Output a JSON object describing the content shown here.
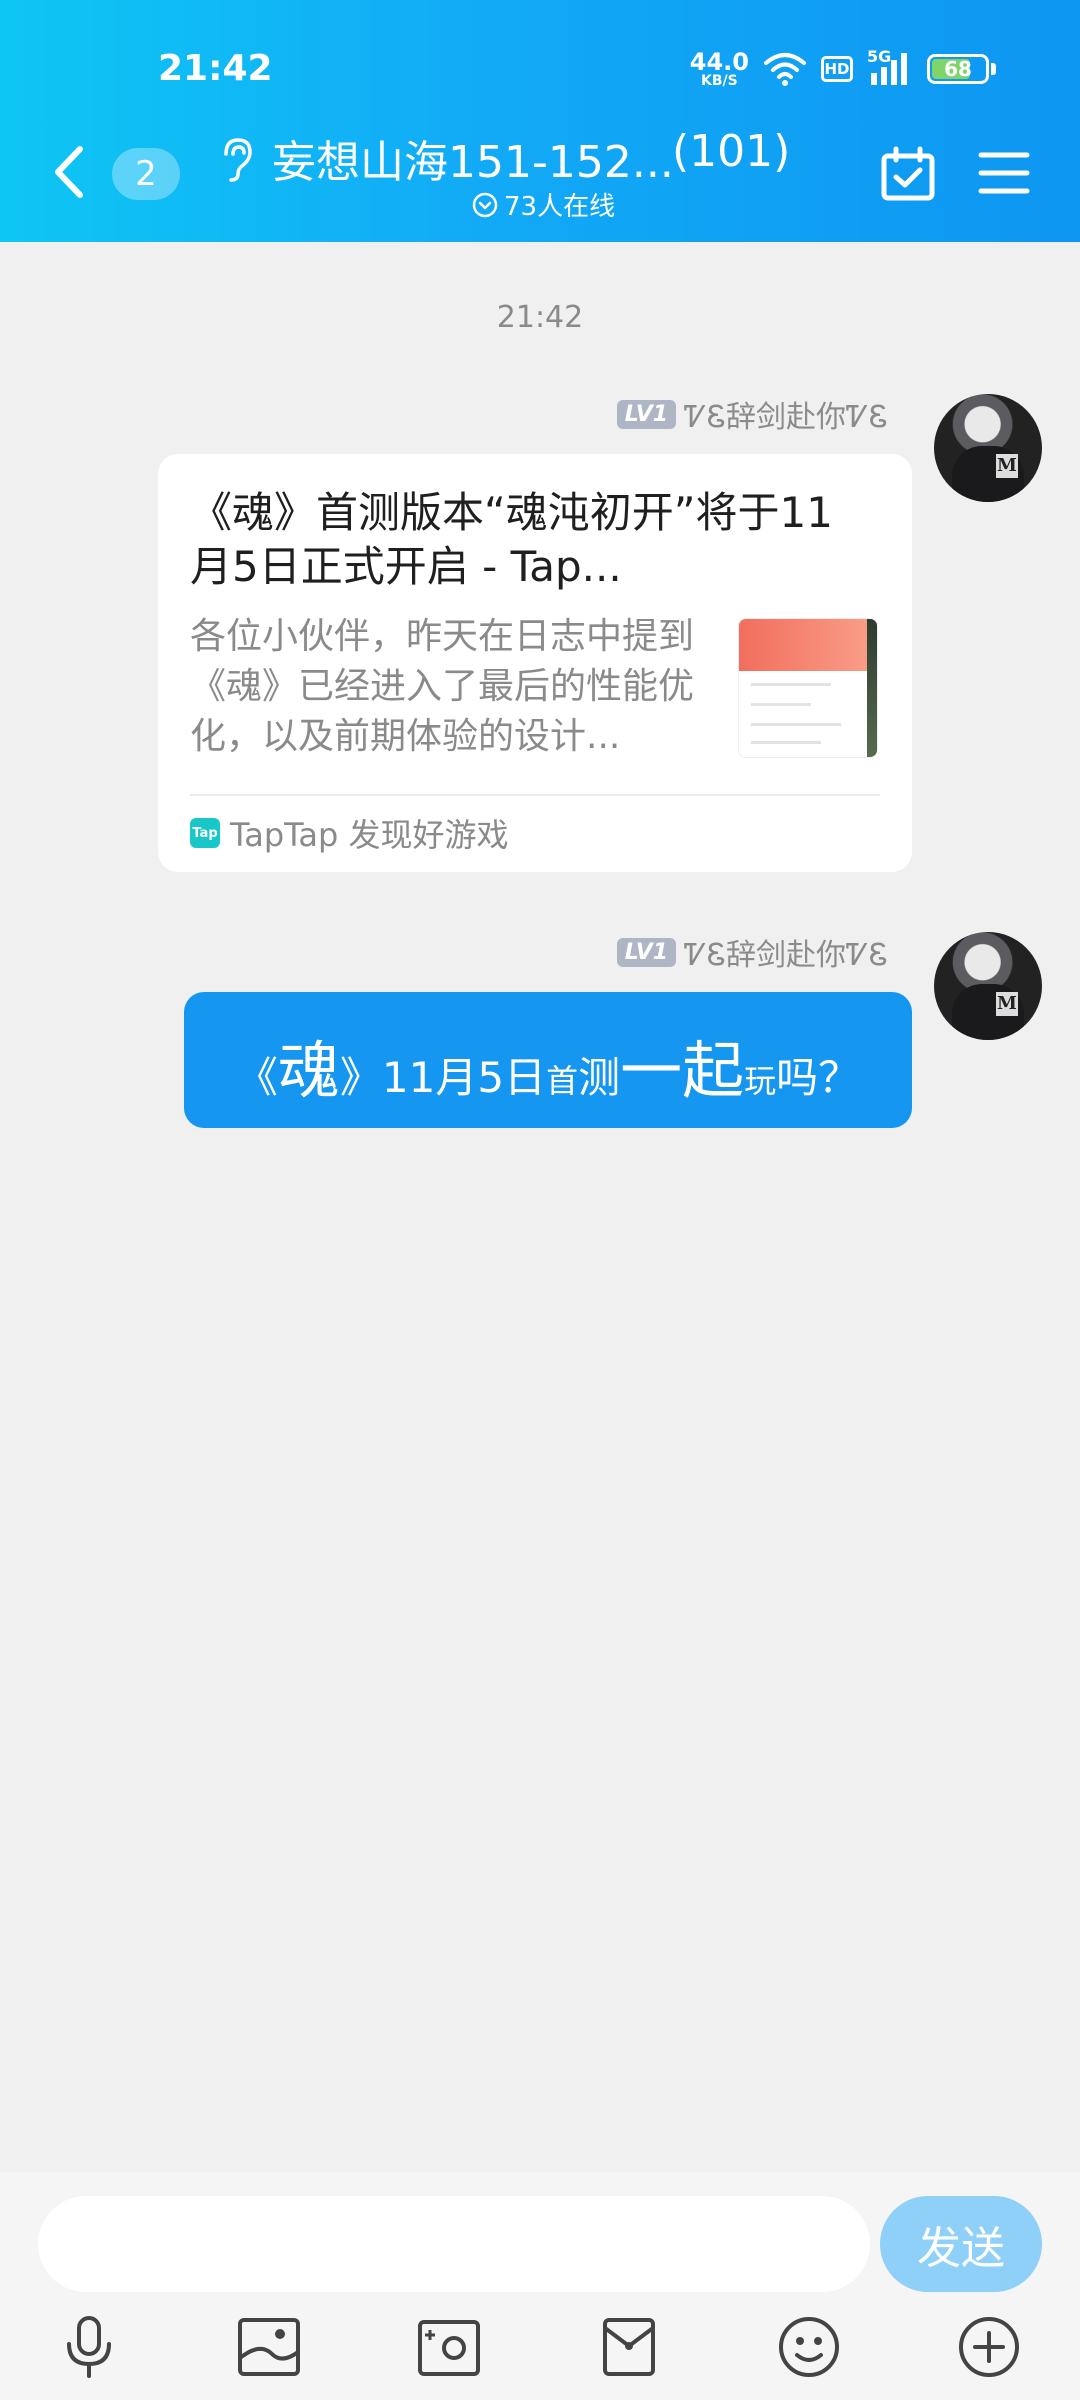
{
  "status_bar": {
    "time": "21:42",
    "net_speed_value": "44.0",
    "net_speed_unit": "KB/S",
    "hd_label": "HD",
    "signal_label": "5G",
    "battery_level": "68"
  },
  "header": {
    "unread_count": "2",
    "title": "妄想山海151-152...",
    "member_count": "(101)",
    "online_text": "73人在线"
  },
  "chat": {
    "time_divider": "21:42",
    "messages": [
      {
        "sender_level": "LV1",
        "sender_name": "ᏤᏋ辞剑赴你ᏤᏋ",
        "card": {
          "title": "《魂》首测版本“魂沌初开”将于11月5日正式开启 - Tap...",
          "description": "各位小伙伴，昨天在日志中提到《魂》已经进入了最后的性能优化，以及前期体验的设计...",
          "source": "TapTap 发现好游戏",
          "source_logo_text": "Tap"
        }
      },
      {
        "sender_level": "LV1",
        "sender_name": "ᏤᏋ辞剑赴你ᏤᏋ",
        "text_parts": [
          "《",
          "魂",
          "》",
          "11月5日",
          "首",
          "测",
          "一起",
          "玩",
          "吗？"
        ]
      }
    ]
  },
  "composer": {
    "input_value": "",
    "input_placeholder": "",
    "send_label": "发送"
  },
  "icons": [
    "back-icon",
    "ear-icon",
    "calendar-check-icon",
    "menu-icon",
    "microphone-icon",
    "image-icon",
    "camera-icon",
    "red-packet-icon",
    "emoji-icon",
    "plus-icon"
  ],
  "colors": {
    "header_start": "#0ec6f4",
    "header_end": "#0d96f2",
    "bubble": "#1596f0",
    "send_button": "#8ed0f8",
    "background": "#f0f0f0"
  }
}
